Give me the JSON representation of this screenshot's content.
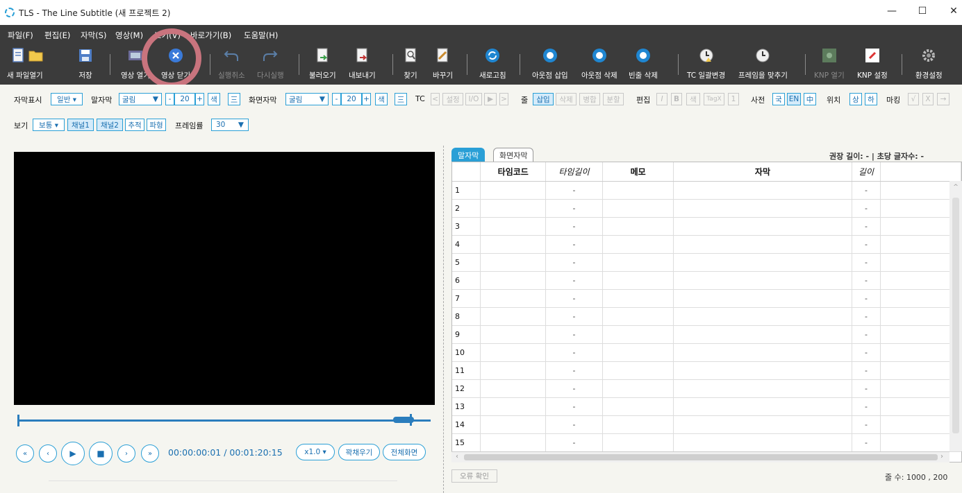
{
  "window": {
    "title": "TLS - The Line Subtitle (새 프로젝트 2)",
    "minimize": "—",
    "maximize": "☐",
    "close": "✕"
  },
  "menu": [
    "파일(F)",
    "편집(E)",
    "자막(S)",
    "영상(M)",
    "보기(V)",
    "바로가기(B)",
    "도움말(H)"
  ],
  "toolbar": [
    {
      "label": "새 파일",
      "icon": "new-file-icon",
      "enabled": true
    },
    {
      "label": "열기",
      "icon": "open-folder-icon",
      "enabled": true
    },
    {
      "label": "저장",
      "icon": "save-icon",
      "enabled": true
    },
    {
      "label": "영상 열기",
      "icon": "open-video-icon",
      "enabled": true
    },
    {
      "label": "영상 닫기",
      "icon": "close-video-icon",
      "enabled": true
    },
    {
      "label": "실행취소",
      "icon": "undo-icon",
      "enabled": false
    },
    {
      "label": "다시실행",
      "icon": "redo-icon",
      "enabled": false
    },
    {
      "label": "불러오기",
      "icon": "import-icon",
      "enabled": true
    },
    {
      "label": "내보내기",
      "icon": "export-icon",
      "enabled": true
    },
    {
      "label": "찾기",
      "icon": "find-icon",
      "enabled": true
    },
    {
      "label": "바꾸기",
      "icon": "replace-icon",
      "enabled": true
    },
    {
      "label": "새로고침",
      "icon": "refresh-icon",
      "enabled": true
    },
    {
      "label": "아웃점 삽입",
      "icon": "outpoint-insert-icon",
      "enabled": true
    },
    {
      "label": "아웃점 삭제",
      "icon": "outpoint-delete-icon",
      "enabled": true
    },
    {
      "label": "빈줄 삭제",
      "icon": "blank-line-delete-icon",
      "enabled": true
    },
    {
      "label": "TC 일괄변경",
      "icon": "tc-batch-icon",
      "enabled": true
    },
    {
      "label": "프레임을 맞추기",
      "icon": "frame-fit-icon",
      "enabled": true
    },
    {
      "label": "KNP 열기",
      "icon": "knp-open-icon",
      "enabled": false
    },
    {
      "label": "KNP 설정",
      "icon": "knp-settings-icon",
      "enabled": true
    },
    {
      "label": "환경설정",
      "icon": "settings-gear-icon",
      "enabled": true
    }
  ],
  "options": {
    "subtitle_display_label": "자막표시",
    "subtitle_display_value": "일반 ▾",
    "speech_label": "말자막",
    "speech_font": "굴림",
    "font_arrow": "▼",
    "minus": "-",
    "plus": "+",
    "speech_size": "20",
    "color": "색",
    "align": "三",
    "screen_label": "화면자막",
    "screen_font": "굴림",
    "screen_size": "20",
    "tc_label": "TC",
    "tc_prev": "<",
    "tc_set": "설정",
    "tc_io": "I/O",
    "tc_play": "▶",
    "tc_next": ">",
    "line_label": "줄",
    "line_insert": "삽입",
    "line_delete": "삭제",
    "line_merge": "병합",
    "line_split": "분할",
    "edit_label": "편집",
    "edit_italic": "I",
    "edit_bold": "B",
    "edit_color": "색",
    "edit_tagx": "TagX",
    "edit_one": "1",
    "dict_label": "사전",
    "dict_ko": "국",
    "dict_en": "EN",
    "dict_zh": "中",
    "pos_label": "위치",
    "pos_top": "상",
    "pos_bottom": "하",
    "mark_label": "마킹",
    "mark_check": "√",
    "mark_x": "X",
    "mark_arrow": "→",
    "view_label": "보기",
    "view_value": "보통 ▾",
    "ch1": "채널1",
    "ch2": "채널2",
    "track": "추적",
    "wave": "파형",
    "framerate_label": "프레임률",
    "framerate_value": "30"
  },
  "player": {
    "rewind_fast": "«",
    "rewind": "‹",
    "play": "▶",
    "stop": "■",
    "forward": "›",
    "forward_fast": "»",
    "time": "00:00:00:01 / 00:01:20:15",
    "speed": "x1.0 ▾",
    "expand": "꽉채우기",
    "fullscreen": "전체화면"
  },
  "tabs": [
    "말자막",
    "화면자막"
  ],
  "recommend": "권장 길이:  -   |   초당 글자수:  -",
  "table": {
    "headers": [
      "",
      "타임코드",
      "타임길이",
      "메모",
      "자막",
      "길이",
      ""
    ],
    "rows": [
      {
        "n": "1",
        "dur": "-",
        "len": "-"
      },
      {
        "n": "2",
        "dur": "-",
        "len": "-"
      },
      {
        "n": "3",
        "dur": "-",
        "len": "-"
      },
      {
        "n": "4",
        "dur": "-",
        "len": "-"
      },
      {
        "n": "5",
        "dur": "-",
        "len": "-"
      },
      {
        "n": "6",
        "dur": "-",
        "len": "-"
      },
      {
        "n": "7",
        "dur": "-",
        "len": "-"
      },
      {
        "n": "8",
        "dur": "-",
        "len": "-"
      },
      {
        "n": "9",
        "dur": "-",
        "len": "-"
      },
      {
        "n": "10",
        "dur": "-",
        "len": "-"
      },
      {
        "n": "11",
        "dur": "-",
        "len": "-"
      },
      {
        "n": "12",
        "dur": "-",
        "len": "-"
      },
      {
        "n": "13",
        "dur": "-",
        "len": "-"
      },
      {
        "n": "14",
        "dur": "-",
        "len": "-"
      },
      {
        "n": "15",
        "dur": "-",
        "len": "-"
      }
    ]
  },
  "error_check": "오류 확인",
  "line_count": "줄 수:  1000 ,  200",
  "colors": {
    "accent": "#2a9fd6",
    "toolbar_bg": "#3b3b3b",
    "highlight": "#c9747e"
  }
}
